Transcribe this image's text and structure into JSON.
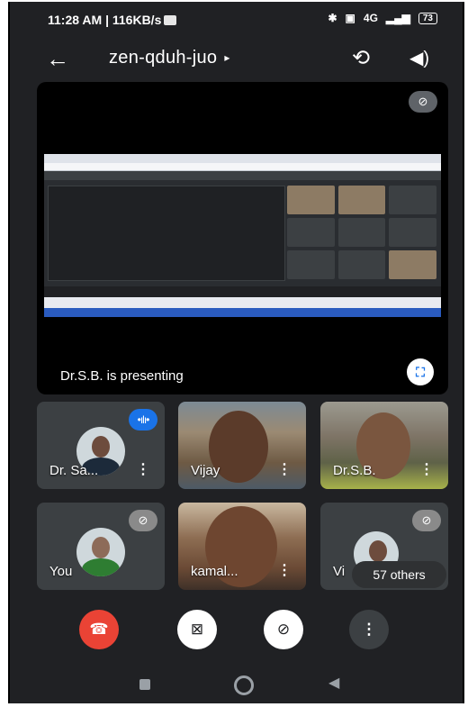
{
  "status_bar": {
    "time": "11:28 AM | 116KB/s",
    "icons": [
      "gmail-icon",
      "bluetooth-icon",
      "nfc-icon",
      "signal-icon"
    ],
    "network": "4G",
    "battery": "73"
  },
  "header": {
    "back_icon": "arrow-left-icon",
    "meeting_code": "zen-qduh-juo",
    "caret": "▸",
    "camera_flip_icon": "camera-flip-icon",
    "speaker_icon": "speaker-icon"
  },
  "presentation": {
    "label": "Dr.S.B. is presenting",
    "muted_icon": "mic-off-icon",
    "expand_icon": "fullscreen-icon"
  },
  "participants": [
    {
      "name": "Dr. Sa...",
      "state": "speaking"
    },
    {
      "name": "Vijay",
      "state": "video"
    },
    {
      "name": "Dr.S.B.",
      "state": "video"
    },
    {
      "name": "You",
      "state": "muted"
    },
    {
      "name": "kamal...",
      "state": "video"
    },
    {
      "name": "Vi",
      "state": "muted"
    }
  ],
  "others_count": "57 others",
  "controls": {
    "end_call_icon": "phone-hangup-icon",
    "camera_off_icon": "video-off-icon",
    "mic_off_icon": "mic-off-icon",
    "more_icon": "more-vertical-icon"
  },
  "colors": {
    "background": "#202124",
    "end_call": "#ea4335",
    "speaking_indicator": "#1a73e8",
    "tile": "#3c4043"
  }
}
